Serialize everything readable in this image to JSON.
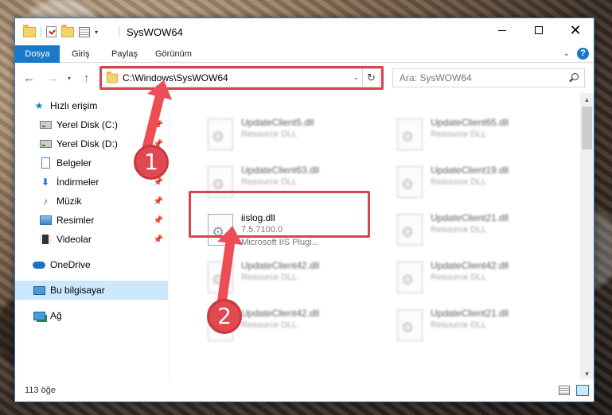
{
  "window": {
    "title": "SysWOW64",
    "minimize": "",
    "maximize": "",
    "close": "✕"
  },
  "ribbon": {
    "tabs": [
      "Dosya",
      "Giriş",
      "Paylaş",
      "Görünüm"
    ],
    "help": "?"
  },
  "address": {
    "path": "C:\\Windows\\SysWOW64",
    "refresh": "↻"
  },
  "search": {
    "placeholder": "Ara: SysWOW64"
  },
  "sidebar": {
    "items": [
      {
        "label": "Hızlı erişim",
        "icon": "star-icon"
      },
      {
        "label": "Yerel Disk (C:)",
        "icon": "disk-icon",
        "pinned": true
      },
      {
        "label": "Yerel Disk (D:)",
        "icon": "disk-icon",
        "pinned": true
      },
      {
        "label": "Belgeler",
        "icon": "document-icon",
        "pinned": true
      },
      {
        "label": "İndirmeler",
        "icon": "download-icon",
        "pinned": true
      },
      {
        "label": "Müzik",
        "icon": "music-icon",
        "pinned": true
      },
      {
        "label": "Resimler",
        "icon": "pictures-icon",
        "pinned": true
      },
      {
        "label": "Videolar",
        "icon": "videos-icon",
        "pinned": true
      },
      {
        "label": "OneDrive",
        "icon": "cloud-icon"
      },
      {
        "label": "Bu bilgisayar",
        "icon": "computer-icon",
        "selected": true
      },
      {
        "label": "Ağ",
        "icon": "network-icon"
      }
    ]
  },
  "files": [
    {
      "name": "UpdateClient5.dll",
      "desc": "Resource DLL"
    },
    {
      "name": "UpdateClient65.dll",
      "desc": "Resource DLL"
    },
    {
      "name": "UpdateClient63.dll",
      "desc": "Resource DLL"
    },
    {
      "name": "UpdateClient19.dll",
      "desc": "Resource DLL"
    },
    {
      "name": "iislog.dll",
      "desc": "7.5.7100.0",
      "extra": "Microsoft IIS Plugi...",
      "highlighted": true
    },
    {
      "name": "UpdateClient21.dll",
      "desc": "Resource DLL"
    },
    {
      "name": "UpdateClient42.dll",
      "desc": "Resource DLL"
    },
    {
      "name": "UpdateClient42.dll",
      "desc": "Resource DLL"
    },
    {
      "name": "UpdateClient42.dll",
      "desc": "Resource DLL"
    },
    {
      "name": "UpdateClient21.dll",
      "desc": "Resource DLL"
    }
  ],
  "status": {
    "item_count": "113 öğe"
  },
  "annotations": {
    "step1": "1",
    "step2": "2",
    "color": "#e24850"
  }
}
